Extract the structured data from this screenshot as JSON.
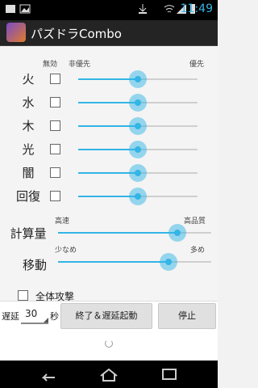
{
  "status_bar": {
    "time": "11:49"
  },
  "header": {
    "title": "パズドラCombo"
  },
  "columns": {
    "disable": "無効",
    "non_priority": "非優先",
    "priority": "優先"
  },
  "orbs": [
    {
      "label": "火",
      "disabled": false,
      "value": 0.5
    },
    {
      "label": "水",
      "disabled": false,
      "value": 0.5
    },
    {
      "label": "木",
      "disabled": false,
      "value": 0.5
    },
    {
      "label": "光",
      "disabled": false,
      "value": 0.5
    },
    {
      "label": "闇",
      "disabled": false,
      "value": 0.5
    },
    {
      "label": "回復",
      "disabled": false,
      "value": 0.5
    }
  ],
  "calc": {
    "label": "計算量",
    "min_label": "高速",
    "max_label": "高品質",
    "value": 0.78
  },
  "move": {
    "label": "移動",
    "min_label": "少なめ",
    "max_label": "多め",
    "value": 0.72
  },
  "full_attack": {
    "label": "全体攻撃",
    "checked": false
  },
  "bottom": {
    "delay_label": "遅延",
    "delay_value": "30",
    "sec_label": "秒",
    "start_button": "終了＆遅延起動",
    "stop_button": "停止"
  },
  "colors": {
    "accent": "#33b5e5"
  }
}
